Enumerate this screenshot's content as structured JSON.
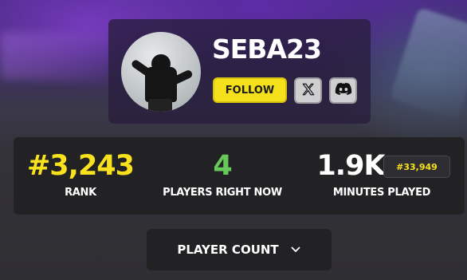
{
  "profile": {
    "username": "SEBA23",
    "follow_label": "FOLLOW",
    "x_icon": "x-logo-icon",
    "discord_icon": "discord-logo-icon"
  },
  "stats": {
    "rank_value": "#3,243",
    "rank_label": "RANK",
    "players_value": "4",
    "players_label": "PLAYERS RIGHT NOW",
    "minutes_value": "1.9K",
    "minutes_rank": "#33,949",
    "minutes_label": "MINUTES PLAYED"
  },
  "dropdown": {
    "label": "PLAYER COUNT",
    "icon": "chevron-down-icon"
  },
  "colors": {
    "accent_yellow": "#f8e21d",
    "accent_green": "#66c95a",
    "panel": "#222124"
  }
}
